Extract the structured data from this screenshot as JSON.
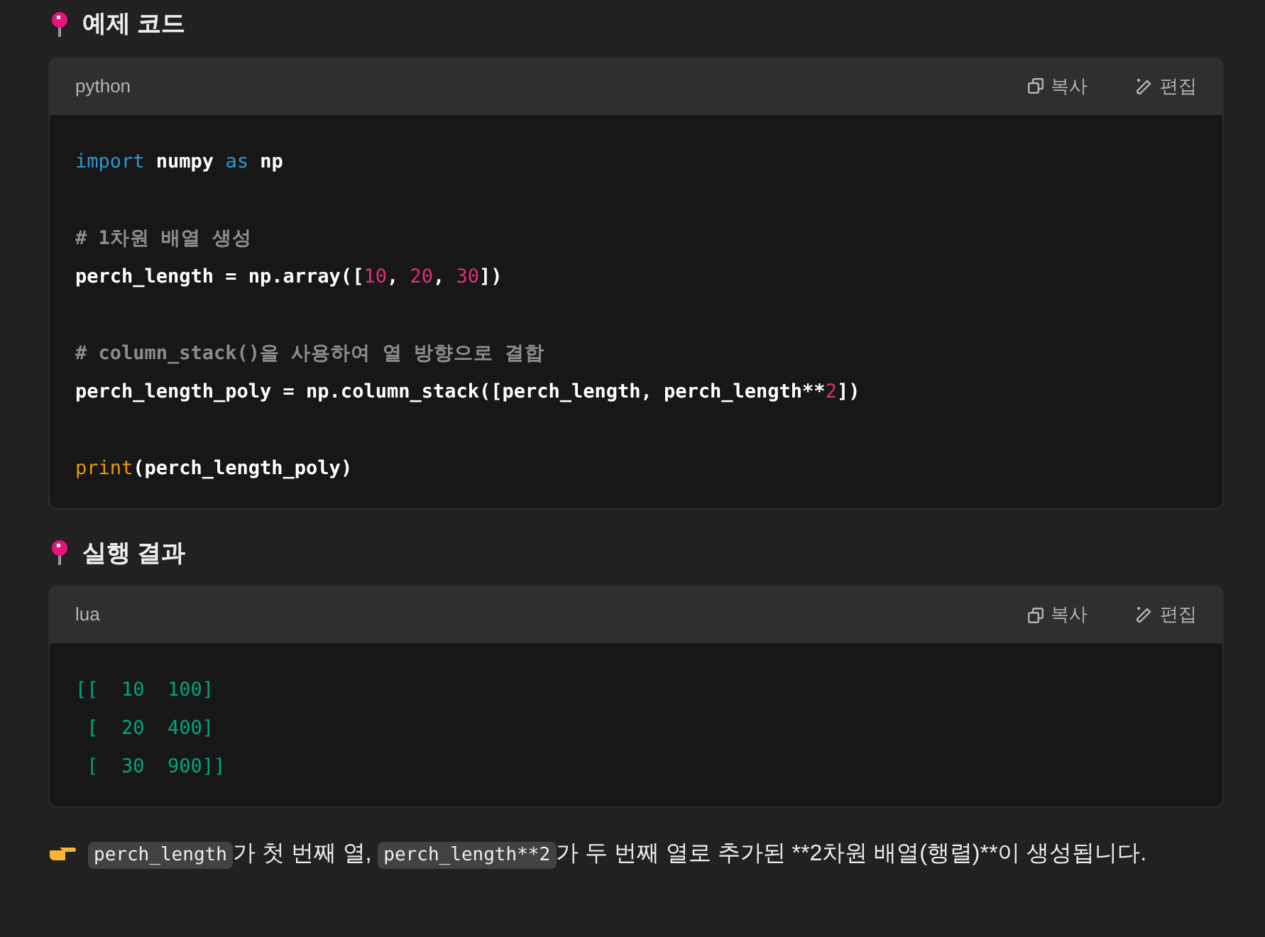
{
  "sections": [
    {
      "heading": "예제 코드",
      "code_block": {
        "language": "python",
        "buttons": [
          {
            "kind": "copy",
            "label": "복사"
          },
          {
            "kind": "edit",
            "label": "편집"
          }
        ],
        "blocks": [
          [
            [
              {
                "text": "import",
                "kind": "keyword"
              },
              {
                "text": " numpy ",
                "kind": "plain"
              },
              {
                "text": "as",
                "kind": "keyword"
              },
              {
                "text": " np",
                "kind": "plain"
              }
            ]
          ],
          [
            [
              {
                "text": "# 1차원 배열 생성",
                "kind": "comment"
              }
            ],
            [
              {
                "text": "perch_length = np.array([",
                "kind": "plain"
              },
              {
                "text": "10",
                "kind": "number"
              },
              {
                "text": ", ",
                "kind": "plain"
              },
              {
                "text": "20",
                "kind": "number"
              },
              {
                "text": ", ",
                "kind": "plain"
              },
              {
                "text": "30",
                "kind": "number"
              },
              {
                "text": "])",
                "kind": "plain"
              }
            ]
          ],
          [
            [
              {
                "text": "# column_stack()을 사용하여 열 방향으로 결합",
                "kind": "comment"
              }
            ],
            [
              {
                "text": "perch_length_poly = np.column_stack([perch_length, perch_length**",
                "kind": "plain"
              },
              {
                "text": "2",
                "kind": "number"
              },
              {
                "text": "])",
                "kind": "plain"
              }
            ]
          ],
          [
            [
              {
                "text": "print",
                "kind": "builtin"
              },
              {
                "text": "(perch_length_poly)",
                "kind": "plain"
              }
            ]
          ]
        ]
      }
    },
    {
      "heading": "실행 결과",
      "code_block": {
        "language": "lua",
        "buttons": [
          {
            "kind": "copy",
            "label": "복사"
          },
          {
            "kind": "edit",
            "label": "편집"
          }
        ],
        "blocks": [
          [
            [
              {
                "text": "[[  10  100]",
                "kind": "output"
              }
            ],
            [
              {
                "text": " [  20  400]",
                "kind": "output"
              }
            ],
            [
              {
                "text": " [  30  900]]",
                "kind": "output"
              }
            ]
          ]
        ]
      }
    }
  ],
  "note": {
    "segments": [
      {
        "text": "perch_length",
        "kind": "code"
      },
      {
        "text": "가 첫 번째 열, ",
        "kind": "text"
      },
      {
        "text": "perch_length**2",
        "kind": "code"
      },
      {
        "text": "가 두 번째 열로 추가된 **2차원 배열(행렬)**이 생성됩니다.",
        "kind": "text"
      }
    ]
  }
}
